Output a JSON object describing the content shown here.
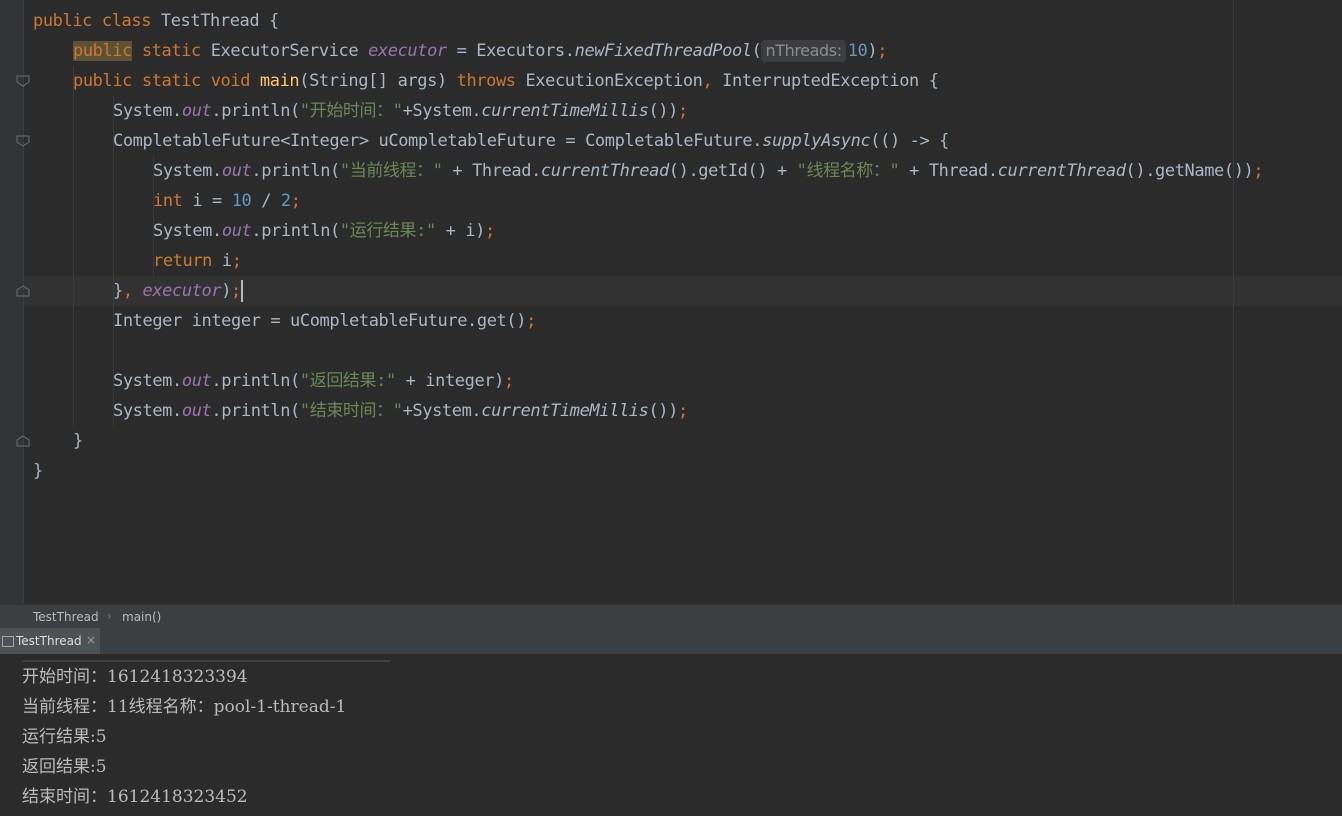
{
  "editor": {
    "lines": [
      [
        [
          "kw",
          "public "
        ],
        [
          "kw",
          "class "
        ],
        [
          "plain",
          "TestThread {"
        ]
      ],
      [
        [
          "kwhl",
          "public"
        ],
        [
          "kw",
          " static "
        ],
        [
          "plain",
          "ExecutorService "
        ],
        [
          "field",
          "executor"
        ],
        [
          "plain",
          " = Executors."
        ],
        [
          "static",
          "newFixedThreadPool"
        ],
        [
          "plain",
          "("
        ],
        [
          "hint",
          "nThreads:"
        ],
        [
          "num",
          "10"
        ],
        [
          "plain",
          ")"
        ],
        [
          "kw",
          ";"
        ]
      ],
      [
        [
          "kw",
          "public "
        ],
        [
          "kw",
          "static "
        ],
        [
          "kw",
          "void "
        ],
        [
          "method",
          "main"
        ],
        [
          "plain",
          "(String[] args) "
        ],
        [
          "kw",
          "throws "
        ],
        [
          "plain",
          "ExecutionException"
        ],
        [
          "kw",
          ", "
        ],
        [
          "plain",
          "InterruptedException {"
        ]
      ],
      [
        [
          "plain",
          "System."
        ],
        [
          "field",
          "out"
        ],
        [
          "plain",
          ".println("
        ],
        [
          "str",
          "\"开始时间：\""
        ],
        [
          "plain",
          "+System."
        ],
        [
          "static",
          "currentTimeMillis"
        ],
        [
          "plain",
          "())"
        ],
        [
          "kw",
          ";"
        ]
      ],
      [
        [
          "plain",
          "CompletableFuture<Integer> uCompletableFuture = CompletableFuture."
        ],
        [
          "static",
          "supplyAsync"
        ],
        [
          "plain",
          "(() -> {"
        ]
      ],
      [
        [
          "plain",
          "System."
        ],
        [
          "field",
          "out"
        ],
        [
          "plain",
          ".println("
        ],
        [
          "str",
          "\"当前线程：\""
        ],
        [
          "plain",
          " + Thread."
        ],
        [
          "static",
          "currentThread"
        ],
        [
          "plain",
          "().getId() + "
        ],
        [
          "str",
          "\"线程名称：\""
        ],
        [
          "plain",
          " + Thread."
        ],
        [
          "static",
          "currentThread"
        ],
        [
          "plain",
          "().getName())"
        ],
        [
          "kw",
          ";"
        ]
      ],
      [
        [
          "kw",
          "int "
        ],
        [
          "plain",
          "i = "
        ],
        [
          "num",
          "10"
        ],
        [
          "plain",
          " / "
        ],
        [
          "num",
          "2"
        ],
        [
          "kw",
          ";"
        ]
      ],
      [
        [
          "plain",
          "System."
        ],
        [
          "field",
          "out"
        ],
        [
          "plain",
          ".println("
        ],
        [
          "str",
          "\"运行结果:\""
        ],
        [
          "plain",
          " + i)"
        ],
        [
          "kw",
          ";"
        ]
      ],
      [
        [
          "kw",
          "return "
        ],
        [
          "plain",
          "i"
        ],
        [
          "kw",
          ";"
        ]
      ],
      [
        [
          "plain",
          "}"
        ],
        [
          "kw",
          ", "
        ],
        [
          "field",
          "executor"
        ],
        [
          "plain",
          ")"
        ],
        [
          "kw",
          ";"
        ],
        [
          "caret",
          ""
        ]
      ],
      [
        [
          "plain",
          "Integer integer = uCompletableFuture.get()"
        ],
        [
          "kw",
          ";"
        ]
      ],
      [],
      [
        [
          "plain",
          "System."
        ],
        [
          "field",
          "out"
        ],
        [
          "plain",
          ".println("
        ],
        [
          "str",
          "\"返回结果:\""
        ],
        [
          "plain",
          " + integer)"
        ],
        [
          "kw",
          ";"
        ]
      ],
      [
        [
          "plain",
          "System."
        ],
        [
          "field",
          "out"
        ],
        [
          "plain",
          ".println("
        ],
        [
          "str",
          "\"结束时间：\""
        ],
        [
          "plain",
          "+System."
        ],
        [
          "static",
          "currentTimeMillis"
        ],
        [
          "plain",
          "())"
        ],
        [
          "kw",
          ";"
        ]
      ],
      [
        [
          "plain",
          "}"
        ]
      ],
      [
        [
          "plain",
          "}"
        ]
      ]
    ]
  },
  "breadcrumb": {
    "class_name": "TestThread",
    "method_name": "main()"
  },
  "run_panel": {
    "tab_label": "TestThread",
    "tab_close": "×",
    "icon": "run-console-icon"
  },
  "console": {
    "lines": [
      "开始时间：1612418323394",
      "当前线程：11线程名称：pool-1-thread-1",
      "运行结果:5",
      "返回结果:5",
      "结束时间：1612418323452"
    ]
  }
}
